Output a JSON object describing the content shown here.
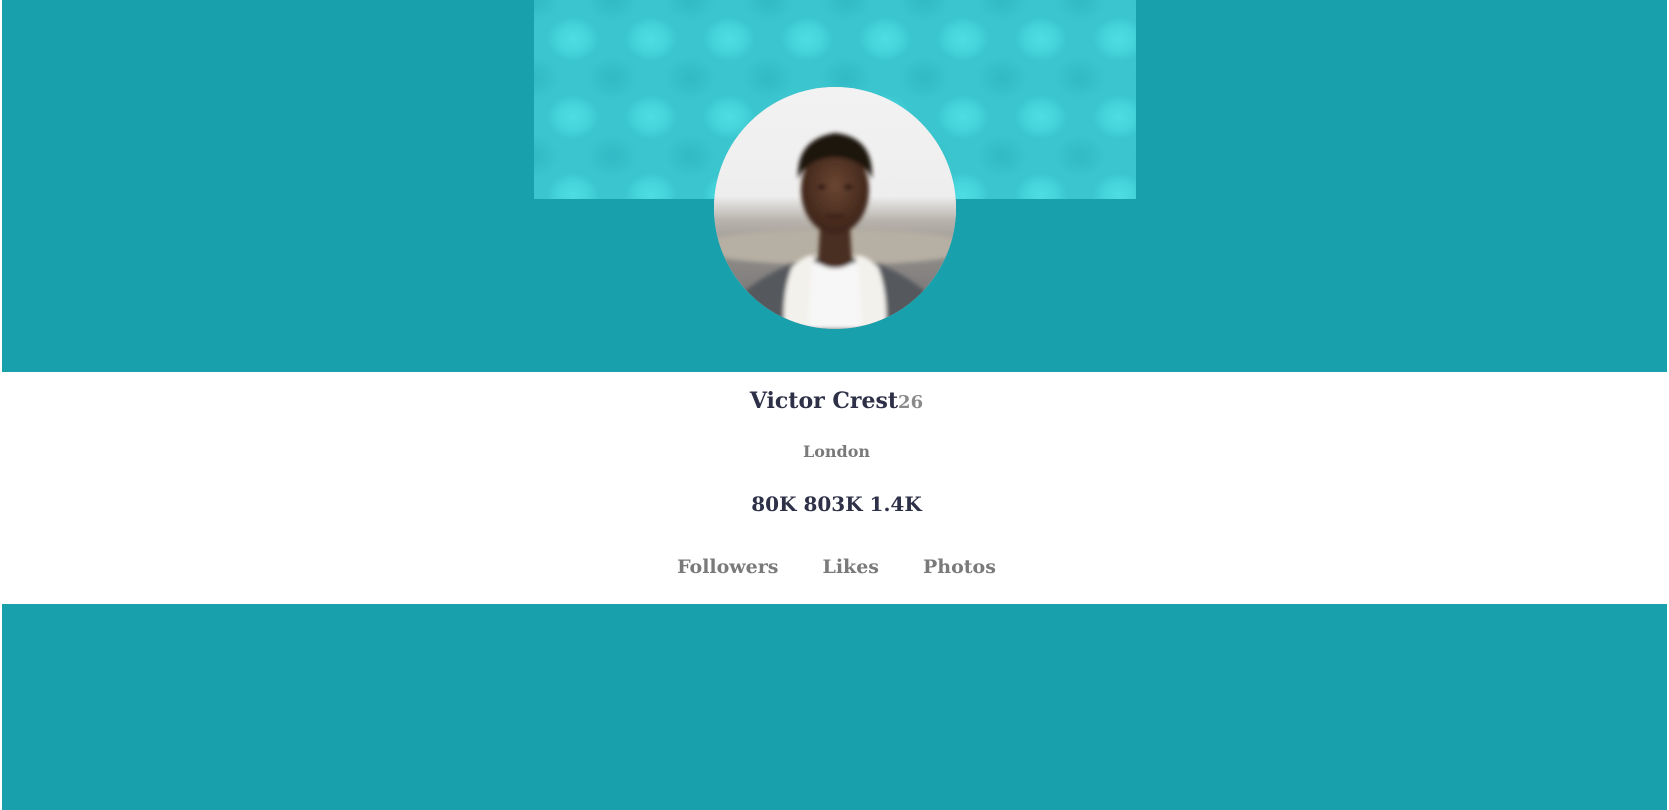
{
  "profile": {
    "name": "Victor Crest",
    "age": "26",
    "city": "London",
    "stats_values": "80K 803K 1.4K",
    "stats_labels": [
      "Followers",
      "Likes",
      "Photos"
    ]
  },
  "colors": {
    "band": "#19a0ad",
    "header_pattern": "#3bc6cf",
    "name_text": "#2e3047",
    "muted_text": "#7a7a7a"
  },
  "icons": {
    "avatar": "profile-photo"
  }
}
